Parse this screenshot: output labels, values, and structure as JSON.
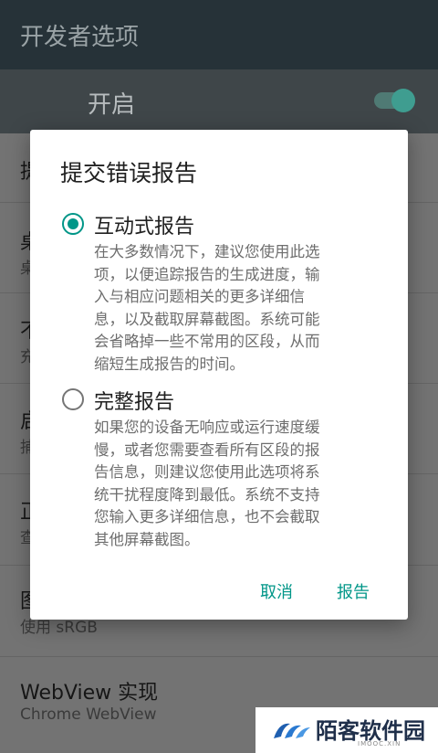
{
  "appbar": {
    "title": "开发者选项"
  },
  "master_switch": {
    "label": "开启",
    "on": true
  },
  "background_rows": [
    {
      "title": "提",
      "summary": ""
    },
    {
      "title": "桌",
      "summary": "桌"
    },
    {
      "title": "不",
      "summary": "充"
    },
    {
      "title": "启",
      "summary": "捕"
    },
    {
      "title": "正",
      "summary": "查"
    },
    {
      "title": "图",
      "summary": "使用 sRGB"
    },
    {
      "title": "WebView 实现",
      "summary": "Chrome WebView"
    }
  ],
  "dialog": {
    "title": "提交错误报告",
    "options": [
      {
        "label": "互动式报告",
        "checked": true,
        "description": [
          "在大多数情况下，建议您使用此选",
          "项，以便追踪报告的生成进度，输",
          "入与相应问题相关的更多详细信",
          "息，以及截取屏幕截图。系统可能",
          "会省略掉一些不常用的区段，从而",
          "缩短生成报告的时间。"
        ]
      },
      {
        "label": "完整报告",
        "checked": false,
        "description": [
          "如果您的设备无响应或运行速度缓",
          "慢，或者您需要查看所有区段的报",
          "告信息，则建议您使用此选项将系",
          "统干扰程度降到最低。系统不支持",
          "您输入更多详细信息，也不会截取",
          "其他屏幕截图。"
        ]
      }
    ],
    "cancel_label": "取消",
    "confirm_label": "报告"
  },
  "colors": {
    "accent": "#009688",
    "appbar": "#263238"
  },
  "watermark": {
    "text": "陌客软件园",
    "sub": "IMOOC.XIN"
  }
}
